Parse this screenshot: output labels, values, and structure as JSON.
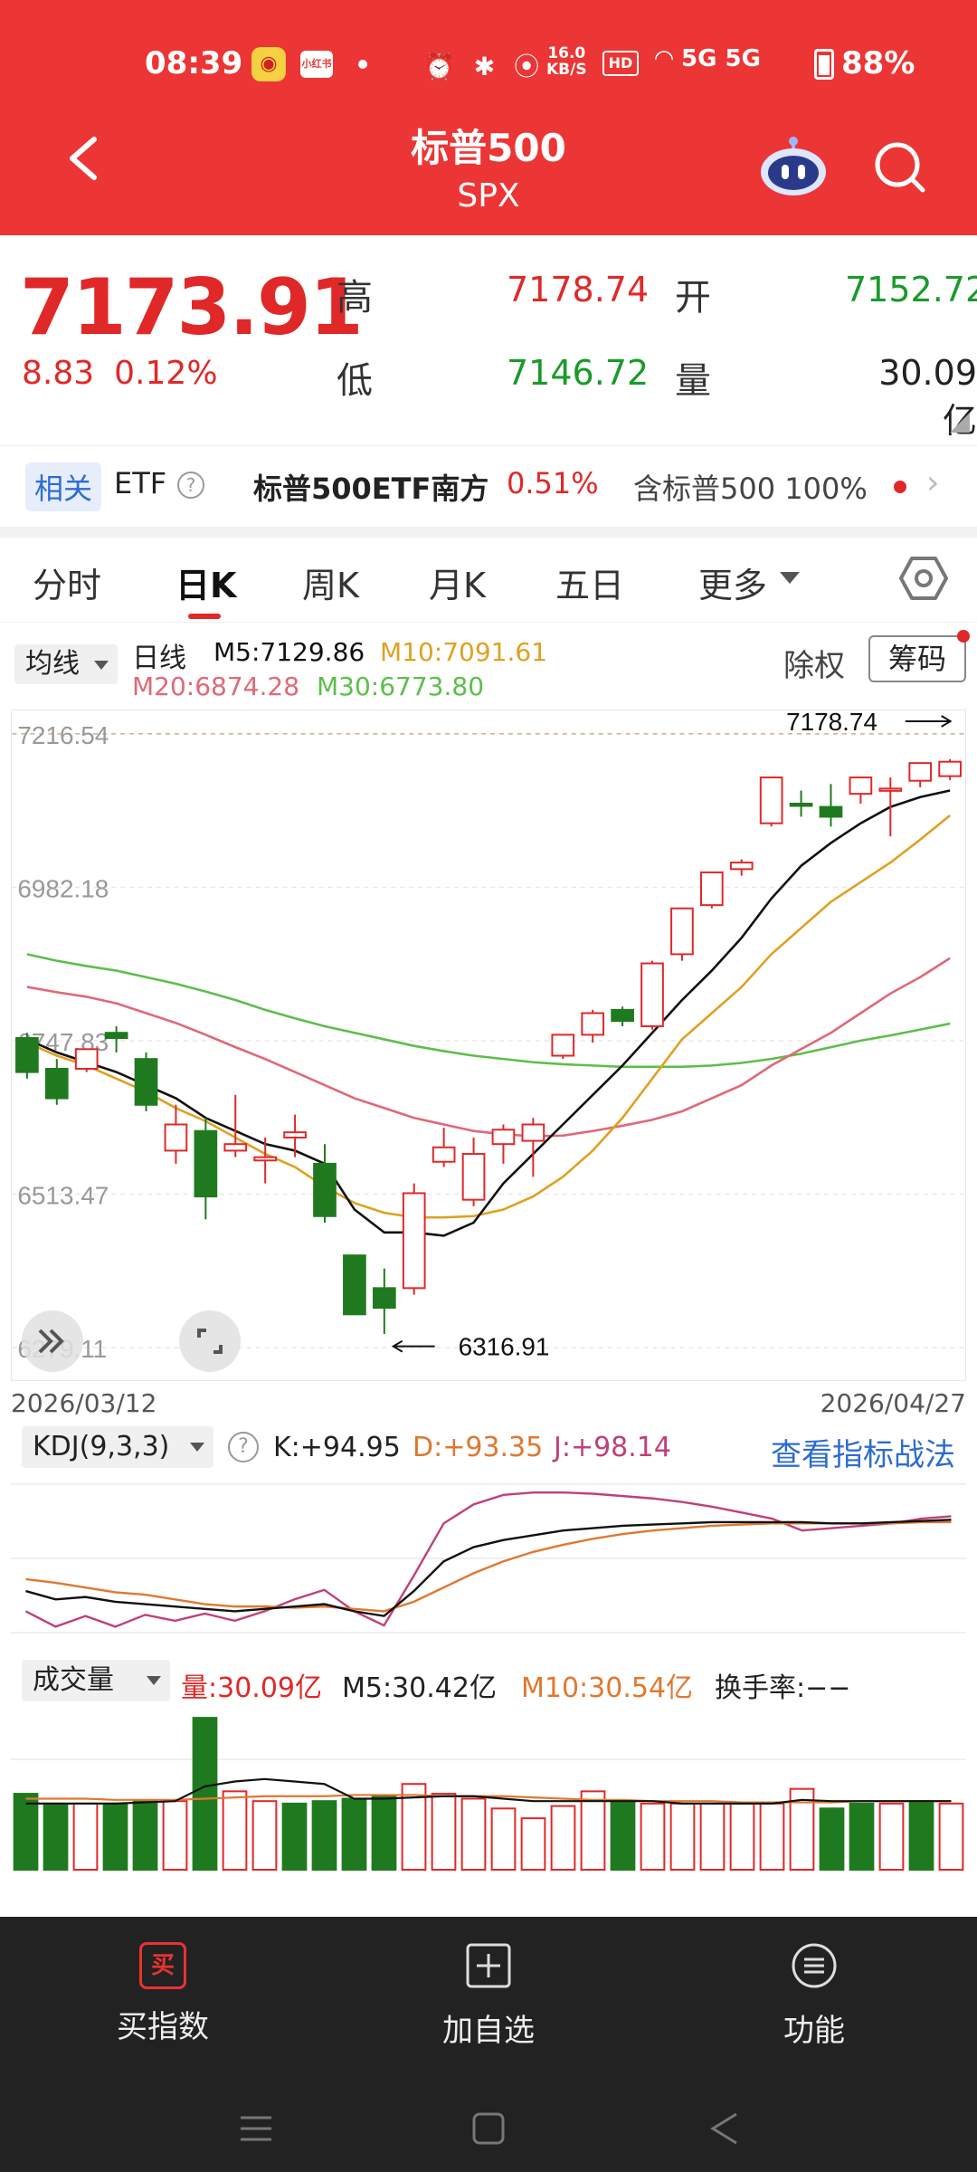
{
  "status": {
    "time": "08:39",
    "speed_value": "16.0",
    "speed_unit": "KB/S",
    "hd": "HD",
    "network": "5G 5G",
    "battery": "88%"
  },
  "header": {
    "title": "标普500",
    "subtitle": "SPX"
  },
  "quote": {
    "price": "7173.91",
    "change": "8.83",
    "change_pct": "0.12%",
    "high_label": "高",
    "high": "7178.74",
    "open_label": "开",
    "open": "7152.72",
    "low_label": "低",
    "low": "7146.72",
    "volume_label": "量",
    "volume": "30.09亿"
  },
  "etf": {
    "tag": "相关",
    "label": "ETF",
    "name": "标普500ETF南方",
    "pct": "0.51%",
    "contain": "含标普500 100%"
  },
  "tabs": [
    "分时",
    "日K",
    "周K",
    "月K",
    "五日",
    "更多"
  ],
  "active_tab": "日K",
  "ma_header": {
    "selector": "均线",
    "period": "日线",
    "m5": "M5:7129.86",
    "m10": "M10:7091.61",
    "m20": "M20:6874.28",
    "m30": "M30:6773.80",
    "fq": "除权",
    "chip": "筹码"
  },
  "colors": {
    "up": "#e02828",
    "down": "#1f7a1f",
    "ma5": "#111111",
    "ma10": "#e0a020",
    "ma20": "#e06878",
    "ma30": "#5cbf4a",
    "header": "#ec3535"
  },
  "chart_data": [
    {
      "type": "candlestick",
      "x_start": "2026/03/12",
      "x_end": "2026/04/27",
      "y_ticks": [
        "7216.54",
        "6982.18",
        "6747.83",
        "6513.47",
        "6279.11"
      ],
      "y_range": [
        6279.11,
        7216.54
      ],
      "annotations": {
        "max": "7178.74",
        "min": "6316.91"
      },
      "candles": [
        {
          "o": 6752,
          "h": 6760,
          "c": 6700,
          "l": 6690
        },
        {
          "o": 6705,
          "h": 6720,
          "c": 6660,
          "l": 6650
        },
        {
          "o": 6705,
          "h": 6730,
          "c": 6735,
          "l": 6700
        },
        {
          "o": 6760,
          "h": 6770,
          "c": 6752,
          "l": 6730
        },
        {
          "o": 6720,
          "h": 6730,
          "c": 6650,
          "l": 6640
        },
        {
          "o": 6580,
          "h": 6650,
          "c": 6620,
          "l": 6560
        },
        {
          "o": 6610,
          "h": 6630,
          "c": 6510,
          "l": 6475
        },
        {
          "o": 6580,
          "h": 6665,
          "c": 6590,
          "l": 6570
        },
        {
          "o": 6565,
          "h": 6600,
          "c": 6570,
          "l": 6530
        },
        {
          "o": 6600,
          "h": 6635,
          "c": 6608,
          "l": 6570
        },
        {
          "o": 6560,
          "h": 6590,
          "c": 6480,
          "l": 6470
        },
        {
          "o": 6420,
          "h": 6420,
          "c": 6330,
          "l": 6330
        },
        {
          "o": 6370,
          "h": 6400,
          "c": 6340,
          "l": 6300
        },
        {
          "o": 6370,
          "h": 6530,
          "c": 6515,
          "l": 6360
        },
        {
          "o": 6563,
          "h": 6615,
          "c": 6585,
          "l": 6555
        },
        {
          "o": 6505,
          "h": 6600,
          "c": 6575,
          "l": 6495
        },
        {
          "o": 6590,
          "h": 6620,
          "c": 6612,
          "l": 6560
        },
        {
          "o": 6595,
          "h": 6630,
          "c": 6620,
          "l": 6540
        },
        {
          "o": 6725,
          "h": 6755,
          "c": 6757,
          "l": 6720
        },
        {
          "o": 6757,
          "h": 6795,
          "c": 6790,
          "l": 6745
        },
        {
          "o": 6795,
          "h": 6800,
          "c": 6778,
          "l": 6770
        },
        {
          "o": 6770,
          "h": 6870,
          "c": 6866,
          "l": 6765
        },
        {
          "o": 6880,
          "h": 6950,
          "c": 6950,
          "l": 6870
        },
        {
          "o": 6955,
          "h": 7000,
          "c": 7005,
          "l": 6950
        },
        {
          "o": 7010,
          "h": 7025,
          "c": 7020,
          "l": 7000
        },
        {
          "o": 7080,
          "h": 7150,
          "c": 7150,
          "l": 7075
        },
        {
          "o": 7110,
          "h": 7130,
          "c": 7108,
          "l": 7090
        },
        {
          "o": 7105,
          "h": 7140,
          "c": 7090,
          "l": 7075
        },
        {
          "o": 7125,
          "h": 7150,
          "c": 7150,
          "l": 7110
        },
        {
          "o": 7130,
          "h": 7150,
          "c": 7133,
          "l": 7060
        },
        {
          "o": 7145,
          "h": 7165,
          "c": 7172,
          "l": 7135
        },
        {
          "o": 7152,
          "h": 7178,
          "c": 7174,
          "l": 7146
        }
      ],
      "ma5": [
        6750,
        6730,
        6715,
        6700,
        6680,
        6660,
        6630,
        6610,
        6590,
        6580,
        6560,
        6490,
        6455,
        6455,
        6450,
        6470,
        6530,
        6575,
        6620,
        6665,
        6710,
        6760,
        6810,
        6855,
        6905,
        6965,
        7015,
        7050,
        7080,
        7105,
        7120,
        7130
      ],
      "ma10": [
        6745,
        6725,
        6710,
        6690,
        6670,
        6645,
        6625,
        6600,
        6575,
        6555,
        6525,
        6500,
        6485,
        6478,
        6478,
        6480,
        6490,
        6510,
        6540,
        6580,
        6630,
        6690,
        6750,
        6790,
        6830,
        6880,
        6920,
        6960,
        6990,
        7020,
        7055,
        7092
      ],
      "ma20": [
        6830,
        6822,
        6815,
        6805,
        6790,
        6775,
        6757,
        6738,
        6720,
        6700,
        6680,
        6660,
        6645,
        6630,
        6620,
        6610,
        6605,
        6602,
        6603,
        6610,
        6618,
        6627,
        6640,
        6660,
        6680,
        6710,
        6735,
        6760,
        6790,
        6820,
        6845,
        6874
      ],
      "ma30": [
        6880,
        6870,
        6862,
        6855,
        6845,
        6835,
        6823,
        6810,
        6795,
        6782,
        6770,
        6760,
        6750,
        6740,
        6732,
        6725,
        6720,
        6715,
        6712,
        6710,
        6708,
        6708,
        6708,
        6710,
        6714,
        6720,
        6728,
        6738,
        6748,
        6756,
        6765,
        6774
      ]
    },
    {
      "type": "line",
      "name": "KDJ(9,3,3)",
      "labels": {
        "k": "K:+94.95",
        "d": "D:+93.35",
        "j": "J:+98.14"
      },
      "k": [
        35,
        28,
        30,
        26,
        24,
        22,
        20,
        18,
        20,
        22,
        24,
        18,
        14,
        35,
        60,
        72,
        78,
        82,
        86,
        88,
        90,
        91,
        92,
        93,
        93,
        93,
        93,
        92,
        92,
        93,
        94,
        95
      ],
      "d": [
        45,
        42,
        38,
        34,
        32,
        28,
        24,
        22,
        22,
        21,
        22,
        20,
        18,
        26,
        38,
        50,
        60,
        68,
        74,
        79,
        83,
        86,
        88,
        90,
        91,
        92,
        92,
        92,
        92,
        92,
        93,
        93
      ],
      "j": [
        18,
        5,
        14,
        5,
        15,
        10,
        16,
        10,
        18,
        28,
        36,
        18,
        6,
        48,
        92,
        108,
        116,
        118,
        118,
        117,
        115,
        113,
        110,
        106,
        101,
        96,
        86,
        88,
        90,
        92,
        96,
        98
      ]
    },
    {
      "type": "bar",
      "name": "成交量",
      "labels": {
        "vol": "量:30.09亿",
        "m5": "M5:30.42亿",
        "m10": "M10:30.54亿",
        "turnover": "换手率:−−"
      },
      "values": [
        31,
        27,
        27,
        27,
        28,
        28,
        62,
        32,
        28,
        27,
        28,
        29,
        30,
        35,
        31,
        29,
        25,
        21,
        26,
        32,
        28,
        27,
        27,
        27,
        27,
        27,
        33,
        25,
        27,
        27,
        28,
        27
      ],
      "up": [
        false,
        false,
        true,
        false,
        false,
        true,
        false,
        true,
        true,
        false,
        false,
        false,
        false,
        true,
        true,
        true,
        true,
        true,
        true,
        true,
        false,
        true,
        true,
        true,
        true,
        true,
        true,
        false,
        false,
        true,
        false,
        true
      ],
      "ma5": [
        27,
        27,
        27,
        27,
        27.5,
        28,
        34,
        36,
        37,
        36,
        35,
        29,
        29,
        29.5,
        30,
        30,
        29,
        28,
        28,
        28,
        28,
        28,
        27,
        27,
        27,
        27,
        28.5,
        28,
        28,
        28,
        28,
        28
      ],
      "ma10": [
        29,
        29,
        29,
        28.5,
        28.5,
        28.5,
        29,
        29.5,
        30,
        30,
        30,
        30.5,
        30.5,
        30.5,
        30,
        30,
        30,
        29.5,
        29,
        28.5,
        28.5,
        28,
        28,
        28,
        27.5,
        27.5,
        27.5,
        27.5,
        28,
        28,
        28,
        28
      ]
    }
  ],
  "bottom": {
    "buy_icon": "买",
    "buy": "买指数",
    "add": "加自选",
    "func": "功能"
  }
}
